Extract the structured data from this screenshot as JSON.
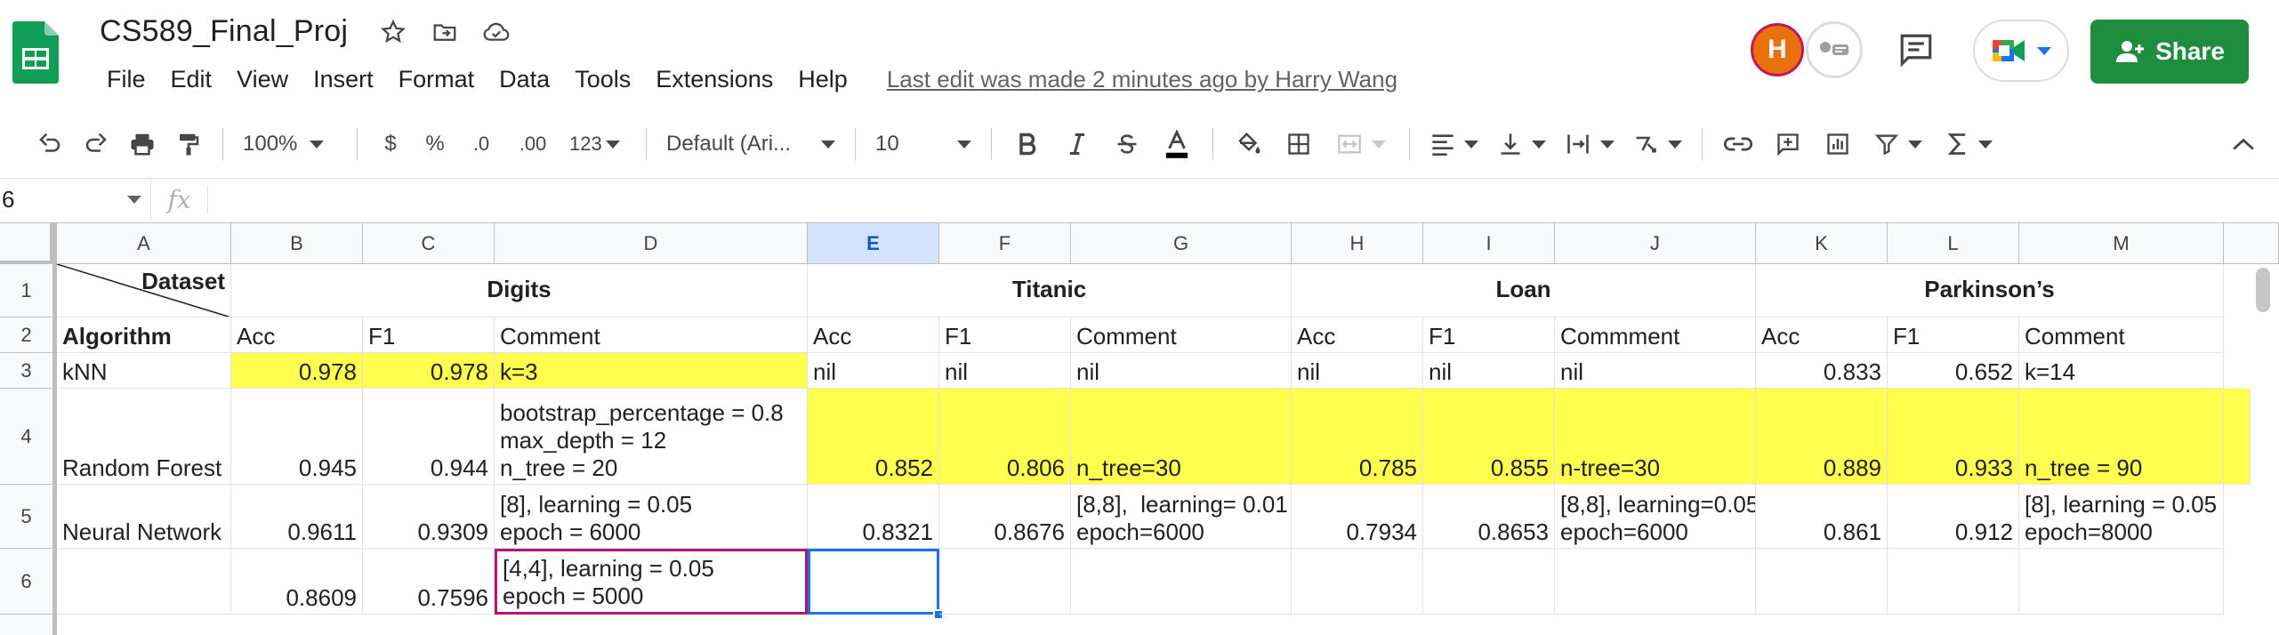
{
  "app": {
    "doc_title": "CS589_Final_Proj",
    "menu": [
      "File",
      "Edit",
      "View",
      "Insert",
      "Format",
      "Data",
      "Tools",
      "Extensions",
      "Help"
    ],
    "last_edit": "Last edit was made 2 minutes ago by Harry Wang",
    "avatar_initial": "H",
    "share_label": "Share",
    "brand_color": "#1e8e3e"
  },
  "toolbar": {
    "zoom": "100%",
    "currency": "$",
    "percent": "%",
    "decrease_decimal": ".0",
    "increase_decimal": ".00",
    "more_formats": "123",
    "font": "Default (Ari...",
    "font_size": "10",
    "icons": [
      "undo-icon",
      "redo-icon",
      "print-icon",
      "paint-format-icon",
      "bold-icon",
      "italic-icon",
      "strikethrough-icon",
      "text-color-icon",
      "fill-color-icon",
      "borders-icon",
      "merge-icon",
      "align-icon",
      "valign-icon",
      "wrap-icon",
      "rotate-icon",
      "link-icon",
      "comment-icon",
      "chart-icon",
      "filter-icon",
      "functions-icon"
    ]
  },
  "formula_bar": {
    "name_box": "6",
    "fx": "fx",
    "value": ""
  },
  "sheet": {
    "columns": [
      "A",
      "B",
      "C",
      "D",
      "E",
      "F",
      "G",
      "H",
      "I",
      "J",
      "K",
      "L",
      "M"
    ],
    "selected_column": "E",
    "rows": [
      "1",
      "2",
      "3",
      "4",
      "5",
      "6"
    ],
    "groups": {
      "digits": "Digits",
      "titanic": "Titanic",
      "loan": "Loan",
      "parkinsons": "Parkinson’s"
    },
    "a1_dataset": "Dataset",
    "a2_algorithm": "Algorithm",
    "headers": {
      "b": "Acc",
      "c": "F1",
      "d": "Comment",
      "e": "Acc",
      "f": "F1",
      "g": "Comment",
      "h": "Acc",
      "i": "F1",
      "j": "Commment",
      "k": "Acc",
      "l": "F1",
      "m": "Comment"
    },
    "r3": {
      "a": "kNN",
      "b": "0.978",
      "c": "0.978",
      "d": "k=3",
      "e": "nil",
      "f": "nil",
      "g": "nil",
      "h": "nil",
      "i": "nil",
      "j": "nil",
      "k": "0.833",
      "l": "0.652",
      "m": "k=14"
    },
    "r4": {
      "a": "Random Forest",
      "b": "0.945",
      "c": "0.944",
      "d": "bootstrap_percentage = 0.8\nmax_depth = 12\nn_tree = 20",
      "e": "0.852",
      "f": "0.806",
      "g": "n_tree=30",
      "h": "0.785",
      "i": "0.855",
      "j": "n-tree=30",
      "k": "0.889",
      "l": "0.933",
      "m": "n_tree = 90"
    },
    "r5": {
      "a": "Neural Network",
      "b": "0.9611",
      "c": "0.9309",
      "d": "[8], learning = 0.05\nepoch = 6000",
      "e": "0.8321",
      "f": "0.8676",
      "g": "[8,8],  learning= 0.01\nepoch=6000",
      "h": "0.7934",
      "i": "0.8653",
      "j": "[8,8], learning=0.05\nepoch=6000",
      "k": "0.861",
      "l": "0.912",
      "m": "[8], learning = 0.05\nepoch=8000"
    },
    "r6": {
      "a": "",
      "b": "0.8609",
      "c": "0.7596",
      "d": "[4,4], learning = 0.05\nepoch = 5000",
      "e": ""
    },
    "highlight_color": "#ffff4d",
    "selection_color": "#1a73e8"
  }
}
